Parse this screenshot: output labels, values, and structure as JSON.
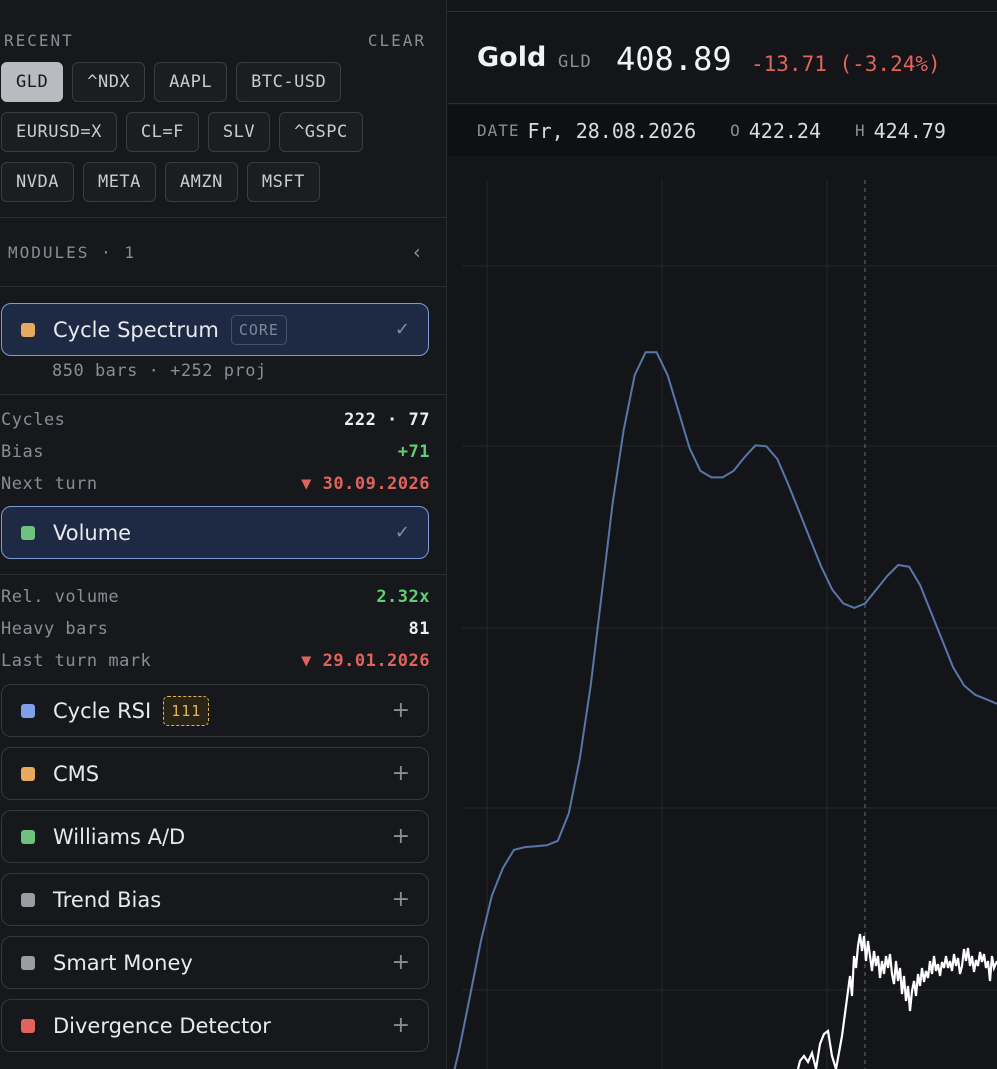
{
  "recent": {
    "title": "RECENT",
    "clear_label": "CLEAR",
    "rows": [
      [
        "GLD",
        "^NDX",
        "AAPL",
        "BTC-USD"
      ],
      [
        "EURUSD=X",
        "CL=F",
        "SLV",
        "^GSPC"
      ],
      [
        "NVDA",
        "META",
        "AMZN",
        "MSFT"
      ]
    ],
    "active": "GLD"
  },
  "modules": {
    "title": "MODULES · 1",
    "collapse_icon": "chevron-left-icon",
    "cycle_spectrum": {
      "name": "Cycle Spectrum",
      "tag": "CORE",
      "check": "✓",
      "color": "#e8a95c",
      "subline": "850 bars · +252 proj",
      "stats": [
        {
          "key": "Cycles",
          "value": "222 · 77"
        },
        {
          "key": "Bias",
          "value": "+71"
        },
        {
          "key": "Next turn",
          "value": "▼ 30.09.2026"
        }
      ]
    },
    "volume": {
      "name": "Volume",
      "check": "✓",
      "color": "#6cc27e",
      "stats": [
        {
          "key": "Rel. volume",
          "value": "2.32x"
        },
        {
          "key": "Heavy bars",
          "value": "81"
        },
        {
          "key": "Last turn mark",
          "value": "▼ 29.01.2026"
        }
      ]
    },
    "inactive": [
      {
        "name": "Cycle RSI",
        "tag": "111",
        "color": "#7f9fe8"
      },
      {
        "name": "CMS",
        "color": "#e8a95c"
      },
      {
        "name": "Williams A/D",
        "color": "#6cc27e"
      },
      {
        "name": "Trend Bias",
        "color": "#9a9ca2"
      },
      {
        "name": "Smart Money",
        "color": "#9a9ca2"
      },
      {
        "name": "Divergence Detector",
        "color": "#e0645c"
      }
    ],
    "add_icon": "+"
  },
  "header": {
    "name": "Gold",
    "symbol": "GLD",
    "price": "408.89",
    "change": "-13.71 (-3.24%)"
  },
  "ohlc": {
    "date_label": "DATE",
    "date": "Fr, 28.08.2026",
    "open_label": "O",
    "open": "422.24",
    "high_label": "H",
    "high": "424.79"
  },
  "colors": {
    "accent_border": "#7b9ad6",
    "active_bg": "#1e2a44",
    "positive": "#5fcf76",
    "negative": "#e0645c",
    "spectrum_line": "#5a76a8",
    "price_line": "#ffffff"
  },
  "chart_data": {
    "type": "line",
    "title": "",
    "xlabel": "",
    "ylabel": "",
    "grid": true,
    "x": [
      0,
      2,
      4,
      6,
      8,
      10,
      12,
      14,
      16,
      18,
      20,
      22,
      24,
      26,
      28,
      30,
      32,
      34,
      36,
      38,
      40,
      42,
      44,
      46,
      48,
      50,
      52,
      54,
      56,
      58,
      60,
      62,
      64,
      66,
      68,
      70,
      72,
      74,
      76,
      78,
      80,
      82,
      84,
      86,
      88,
      90,
      92,
      94,
      96,
      98,
      100
    ],
    "ylim": [
      0,
      100
    ],
    "series": [
      {
        "values": [
          -3,
          2,
          8,
          14,
          19,
          22,
          24,
          24.3,
          24.4,
          24.5,
          25,
          28,
          34,
          42,
          52,
          62,
          70,
          76,
          78.5,
          78.5,
          76,
          72,
          68,
          65.5,
          64.8,
          64.8,
          65.5,
          67,
          68.3,
          68.2,
          66.8,
          64,
          61,
          58,
          55,
          52.5,
          51,
          50.5,
          51,
          52.5,
          54,
          55.2,
          55,
          53,
          50,
          47,
          44,
          42,
          41,
          40.5,
          40
        ]
      },
      {
        "values": [
          null,
          null,
          null,
          null,
          null,
          null,
          null,
          null,
          null,
          null,
          null,
          null,
          null,
          null,
          null,
          null,
          null,
          null,
          null,
          null,
          null,
          null,
          null,
          null,
          null,
          null,
          null,
          null,
          null,
          null,
          null,
          null,
          null,
          null,
          null,
          null,
          null,
          null,
          null,
          null,
          null,
          null,
          null,
          null,
          null,
          null,
          null,
          null,
          null,
          null,
          null
        ]
      }
    ]
  }
}
